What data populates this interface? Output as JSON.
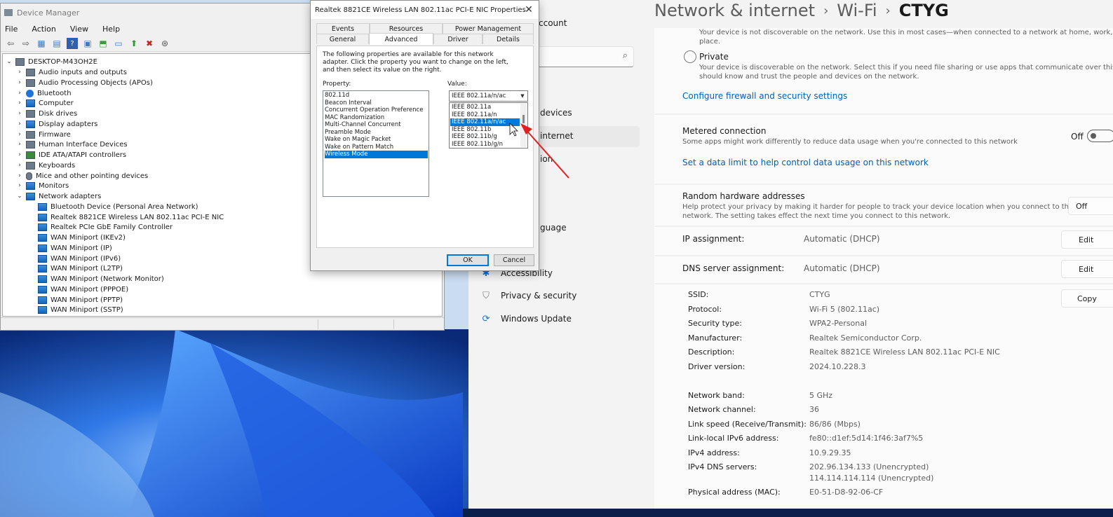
{
  "desktop": {
    "wallpaper": "windows-11-bloom"
  },
  "device_manager": {
    "title": "Device Manager",
    "menu": [
      "File",
      "Action",
      "View",
      "Help"
    ],
    "toolbar_icons": [
      "back-icon",
      "forward-icon",
      "properties-icon",
      "help-icon",
      "update-driver-icon",
      "monitor-icon",
      "enable-device-icon",
      "uninstall-icon",
      "download-icon"
    ],
    "tree": {
      "root": "DESKTOP-M43OH2E",
      "categories": [
        "Audio inputs and outputs",
        "Audio Processing Objects (APOs)",
        "Bluetooth",
        "Computer",
        "Disk drives",
        "Display adapters",
        "Firmware",
        "Human Interface Devices",
        "IDE ATA/ATAPI controllers",
        "Keyboards",
        "Mice and other pointing devices",
        "Monitors",
        "Network adapters"
      ],
      "network_adapters": [
        "Bluetooth Device (Personal Area Network)",
        "Realtek 8821CE Wireless LAN 802.11ac PCI-E NIC",
        "Realtek PCIe GbE Family Controller",
        "WAN Miniport (IKEv2)",
        "WAN Miniport (IP)",
        "WAN Miniport (IPv6)",
        "WAN Miniport (L2TP)",
        "WAN Miniport (Network Monitor)",
        "WAN Miniport (PPPOE)",
        "WAN Miniport (PPTP)",
        "WAN Miniport (SSTP)"
      ]
    }
  },
  "dialog": {
    "title": "Realtek 8821CE Wireless LAN 802.11ac PCI-E NIC Properties",
    "tabs_top": [
      "Events",
      "Resources",
      "Power Management"
    ],
    "tabs_bottom": [
      "General",
      "Advanced",
      "Driver",
      "Details"
    ],
    "active_tab": "Advanced",
    "intro": "The following properties are available for this network adapter. Click the property you want to change on the left, and then select its value on the right.",
    "property_label": "Property:",
    "properties": [
      "802.11d",
      "Beacon Interval",
      "Concurrent Operation Preference",
      "MAC Randomization",
      "Multi-Channel Concurrent",
      "Preamble Mode",
      "Wake on Magic Packet",
      "Wake on Pattern Match",
      "Wireless Mode"
    ],
    "selected_property": "Wireless Mode",
    "value_label": "Value:",
    "value_selected": "IEEE 802.11a/n/ac",
    "value_options": [
      "IEEE 802.11a",
      "IEEE 802.11a/n",
      "IEEE 802.11a/n/ac",
      "IEEE 802.11b",
      "IEEE 802.11b/g",
      "IEEE 802.11b/g/n"
    ],
    "highlighted_option": "IEEE 802.11a/n/ac",
    "ok": "OK",
    "cancel": "Cancel"
  },
  "settings": {
    "nav_fragments": {
      "account": "ccount",
      "devices": "devices",
      "internet": "internet",
      "ion": "ion",
      "language": "guage"
    },
    "nav_items": [
      {
        "label": "Accessibility",
        "icon": "accessibility-icon"
      },
      {
        "label": "Privacy & security",
        "icon": "shield-icon"
      },
      {
        "label": "Windows Update",
        "icon": "update-icon"
      }
    ],
    "breadcrumb": [
      "Network & internet",
      "Wi-Fi",
      "CTYG"
    ],
    "public_desc": "Your device is not discoverable on the network. Use this in most cases—when connected to a network at home, work, or in a publ",
    "public_desc2": "place.",
    "private_label": "Private",
    "private_desc": "Your device is discoverable on the network. Select this if you need file sharing or use apps that communicate over this network. Yo",
    "private_desc2": "should know and trust the people and devices on the network.",
    "firewall_link": "Configure firewall and security settings",
    "metered_title": "Metered connection",
    "metered_desc": "Some apps might work differently to reduce data usage when you're connected to this network",
    "metered_state": "Off",
    "data_limit_link": "Set a data limit to help control data usage on this network",
    "random_title": "Random hardware addresses",
    "random_desc": "Help protect your privacy by making it harder for people to track your device location when you connect to this",
    "random_desc2": "network. The setting takes effect the next time you connect to this network.",
    "random_value": "Off",
    "ip_assignment": {
      "label": "IP assignment:",
      "value": "Automatic (DHCP)",
      "button": "Edit"
    },
    "dns_assignment": {
      "label": "DNS server assignment:",
      "value": "Automatic (DHCP)",
      "button": "Edit"
    },
    "copy_button": "Copy",
    "properties": [
      {
        "k": "SSID:",
        "v": "CTYG"
      },
      {
        "k": "Protocol:",
        "v": "Wi-Fi 5 (802.11ac)"
      },
      {
        "k": "Security type:",
        "v": "WPA2-Personal"
      },
      {
        "k": "Manufacturer:",
        "v": "Realtek Semiconductor Corp."
      },
      {
        "k": "Description:",
        "v": "Realtek 8821CE Wireless LAN 802.11ac PCI-E NIC"
      },
      {
        "k": "Driver version:",
        "v": "2024.10.228.3"
      },
      {
        "k": "Network band:",
        "v": "5 GHz"
      },
      {
        "k": "Network channel:",
        "v": "36"
      },
      {
        "k": "Link speed (Receive/Transmit):",
        "v": "86/86 (Mbps)"
      },
      {
        "k": "Link-local IPv6 address:",
        "v": "fe80::d1ef:5d14:1f46:3af7%5"
      },
      {
        "k": "IPv4 address:",
        "v": "10.9.29.35"
      },
      {
        "k": "IPv4 DNS servers:",
        "v": "202.96.134.133 (Unencrypted)"
      },
      {
        "k": "Physical address (MAC):",
        "v": "E0-51-D8-92-06-CF"
      }
    ],
    "dns_server_2": "114.114.114.114 (Unencrypted)"
  },
  "colors": {
    "accent": "#0078d7",
    "link": "#005fb8",
    "annotation_arrow": "#e02020"
  }
}
